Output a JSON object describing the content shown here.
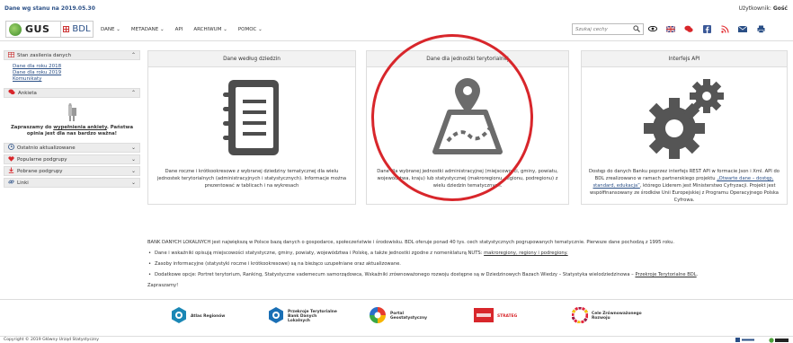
{
  "top": {
    "date": "Dane wg stanu na 2019.05.30",
    "user_label": "Użytkownik:",
    "user_name": "Gość"
  },
  "logo": {
    "gus": "GUS",
    "bdl": "BDL"
  },
  "menu": {
    "items": [
      "DANE",
      "METADANE",
      "API",
      "ARCHIWUM",
      "POMOC"
    ]
  },
  "search": {
    "placeholder": "Szukaj cechy"
  },
  "sidebar": {
    "stan": {
      "title": "Stan zasilenia danych",
      "links": [
        "Dane dla roku 2018",
        "Dane dla roku 2019",
        "Komunikaty"
      ]
    },
    "ankieta": {
      "title": "Ankieta",
      "text_prefix": "Zapraszamy do ",
      "text_link": "wypełnienia ankiety",
      "text_suffix": ". Państwa opinia jest dla nas bardzo ważna!"
    },
    "sections": [
      "Ostatnio aktualizowane",
      "Popularne podgrupy",
      "Pobrane podgrupy",
      "Linki"
    ]
  },
  "tiles": {
    "dziedzin": {
      "title": "Dane według dziedzin",
      "desc": "Dane roczne i krótkookresowe z wybranej dziedziny tematycznej dla wielu jednostek terytorialnych (administracyjnych i statystycznych). Informacje można prezentować w tablicach i na wykresach"
    },
    "jednostki": {
      "title": "Dane dla jednostki terytorialnej",
      "desc": "Dane dla wybranej jednostki administracyjnej (miejscowości, gminy, powiatu, województwa, kraju) lub statystycznej (makroregionu, regionu, podregionu) z wielu dziedzin tematycznych."
    },
    "api": {
      "title": "Interfejs API",
      "desc_1": "Dostęp do danych Banku poprzez interfejs REST API w formacie Json i Xml. API do BDL zrealizowano w ramach partnerskiego projektu ",
      "desc_link": "„Otwarte dane – dostęp, standard, edukacja”",
      "desc_2": ", którego Liderem jest Ministerstwo Cyfryzacji. Projekt jest współfinansowany ze środków Unii Europejskiej z Programu Operacyjnego Polska Cyfrowa."
    }
  },
  "info": {
    "intro": "BANK DANYCH LOKALNYCH jest największą w Polsce bazą danych o gospodarce, społeczeństwie i środowisku. BDL oferuje ponad 40 tys. cech statystycznych pogrupowanych tematycznie. Pierwsze dane pochodzą z 1995 roku.",
    "b1_prefix": "Dane i wskaźniki opisują miejscowości statystyczne, gminy, powiaty, województwa i Polskę, a także jednostki zgodne z nomenklaturą NUTS: ",
    "b1_link": "makroregiony, regiony i podregiony.",
    "b2": "Zasoby informacyjne (statystyki roczne i krótkookresowe) są na bieżąco uzupełniane oraz aktualizowane.",
    "b3_prefix": "Dodatkowe opcje: Portret terytorium, Ranking, Statystyczne vademecum samorządowca, Wskaźniki zrównoważonego rozwoju dostępne są w Dziedzinowych Bazach Wiedzy – Statystyka wielodziedzinowa – ",
    "b3_link": "Przekroje Terytorialne BDL",
    "b3_suffix": ".",
    "closing": "Zapraszamy!"
  },
  "partners": [
    {
      "label": "Atlas Regionów"
    },
    {
      "label": "Przekroje Terytorialne Bank Danych Lokalnych"
    },
    {
      "label": "Portal Geostatystyczny"
    },
    {
      "label": "STRATEG"
    },
    {
      "label": "Cele Zrównoważonego Rozwoju"
    }
  ],
  "footer": {
    "copyright": "Copyright © 2019 Główny Urząd Statystyczny"
  },
  "colors": {
    "brand_blue": "#2a4f86",
    "annotation_red": "#d8262b",
    "icon_gray": "#4d4d4d",
    "api_gray": "#555555"
  },
  "icons": [
    "search-icon",
    "eye-icon",
    "uk-flag-icon",
    "chat-icon",
    "facebook-icon",
    "rss-icon",
    "mail-icon",
    "printer-icon"
  ]
}
